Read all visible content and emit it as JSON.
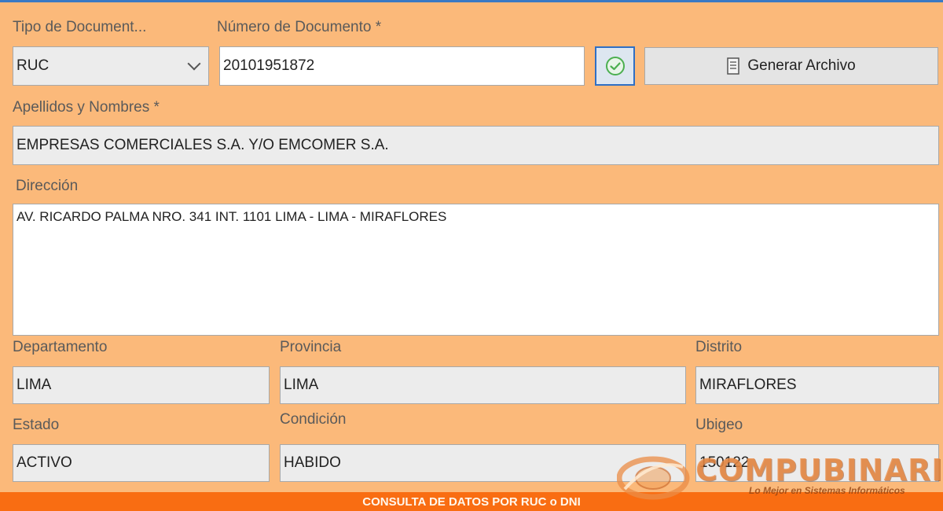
{
  "labels": {
    "tipo_documento": "Tipo de Document...",
    "numero_documento": "Número de Documento *",
    "apellidos_nombres": "Apellidos y Nombres *",
    "direccion": "Dirección",
    "departamento": "Departamento",
    "provincia": "Provincia",
    "distrito": "Distrito",
    "estado": "Estado",
    "condicion": "Condición",
    "ubigeo": "Ubigeo"
  },
  "values": {
    "tipo_documento": "RUC",
    "numero_documento": "20101951872",
    "apellidos_nombres": "EMPRESAS COMERCIALES S.A. Y/O EMCOMER S.A.",
    "direccion": "AV. RICARDO PALMA NRO. 341 INT. 1101 LIMA - LIMA - MIRAFLORES",
    "departamento": "LIMA",
    "provincia": "LIMA",
    "distrito": "MIRAFLORES",
    "estado": "ACTIVO",
    "condicion": "HABIDO",
    "ubigeo": "150122"
  },
  "buttons": {
    "generar_archivo": "Generar Archivo"
  },
  "footer": {
    "title": "CONSULTA DE DATOS POR RUC o DNI"
  },
  "watermark": {
    "name": "COMPUBINARIO",
    "tagline": "Lo Mejor en Sistemas Informáticos"
  },
  "colors": {
    "background": "#fbb97a",
    "footer": "#f96d12",
    "accent": "#2f6fc4",
    "check": "#4caf50"
  },
  "icons": {
    "validate": "check-circle-icon",
    "generate": "document-icon",
    "dropdown": "chevron-down-icon"
  }
}
